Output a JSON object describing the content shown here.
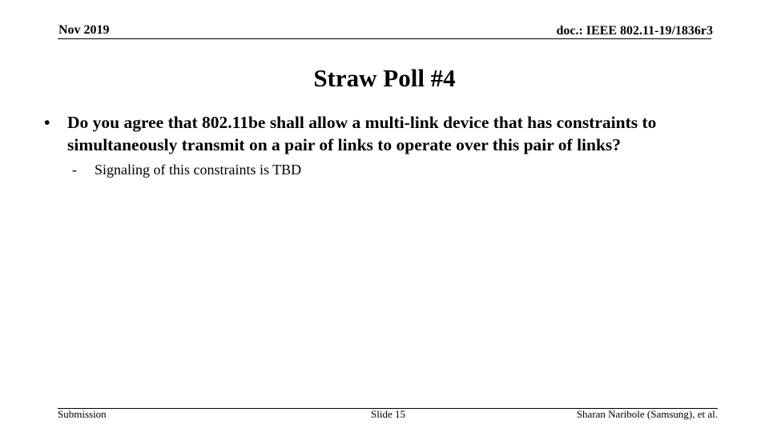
{
  "header": {
    "date": "Nov 2019",
    "doc_id": "doc.: IEEE 802.11-19/1836r3"
  },
  "slide": {
    "title": "Straw Poll #4",
    "bullets": [
      {
        "marker": "•",
        "text": "Do you agree that 802.11be shall allow a multi-link device that has constraints to simultaneously transmit on a pair of links to operate over this pair of links?",
        "sub_bullets": [
          {
            "marker": "-",
            "text": "Signaling of this constraints is TBD"
          }
        ]
      }
    ]
  },
  "footer": {
    "left": "Submission",
    "center": "Slide 15",
    "right": "Sharan Naribole (Samsung), et al."
  }
}
